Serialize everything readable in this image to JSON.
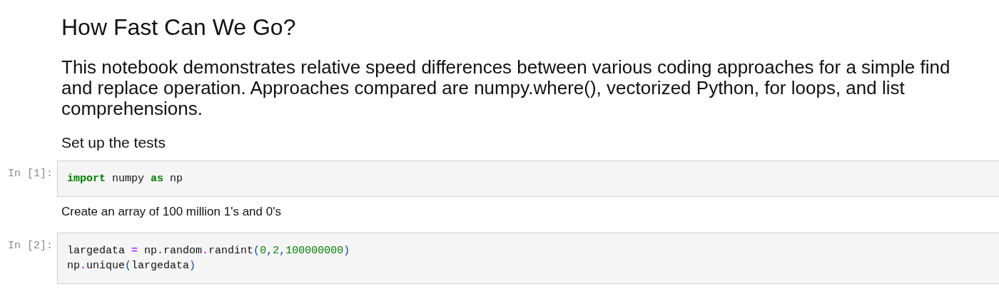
{
  "cells": [
    {
      "kind": "h1",
      "text": "How Fast Can We Go?"
    },
    {
      "kind": "h2",
      "text": "This notebook demonstrates relative speed differences between various coding approaches for a simple find and replace operation. Approaches compared are numpy.where(), vectorized Python, for loops, and list comprehensions."
    },
    {
      "kind": "h3",
      "text": "Set up the tests"
    },
    {
      "kind": "code",
      "prompt": "In [1]:",
      "lines": [
        [
          {
            "kind": "keyword",
            "text": "import"
          },
          {
            "kind": "name",
            "text": " numpy "
          },
          {
            "kind": "keyword",
            "text": "as"
          },
          {
            "kind": "name",
            "text": " np"
          }
        ]
      ]
    },
    {
      "kind": "text",
      "text": "Create an array of 100 million 1's and 0's"
    },
    {
      "kind": "code",
      "prompt": "In [2]:",
      "lines": [
        [
          {
            "kind": "name",
            "text": "largedata "
          },
          {
            "kind": "operator",
            "text": "="
          },
          {
            "kind": "name",
            "text": " np"
          },
          {
            "kind": "operator",
            "text": "."
          },
          {
            "kind": "name",
            "text": "random"
          },
          {
            "kind": "operator",
            "text": "."
          },
          {
            "kind": "name",
            "text": "randint"
          },
          {
            "kind": "punct",
            "text": "("
          },
          {
            "kind": "number",
            "text": "0"
          },
          {
            "kind": "punct",
            "text": ","
          },
          {
            "kind": "number",
            "text": "2"
          },
          {
            "kind": "punct",
            "text": ","
          },
          {
            "kind": "number",
            "text": "100000000"
          },
          {
            "kind": "punct",
            "text": ")"
          }
        ],
        [
          {
            "kind": "name",
            "text": "np"
          },
          {
            "kind": "operator",
            "text": "."
          },
          {
            "kind": "name",
            "text": "unique"
          },
          {
            "kind": "punct",
            "text": "("
          },
          {
            "kind": "name",
            "text": "largedata"
          },
          {
            "kind": "punct",
            "text": ")"
          }
        ]
      ]
    }
  ]
}
